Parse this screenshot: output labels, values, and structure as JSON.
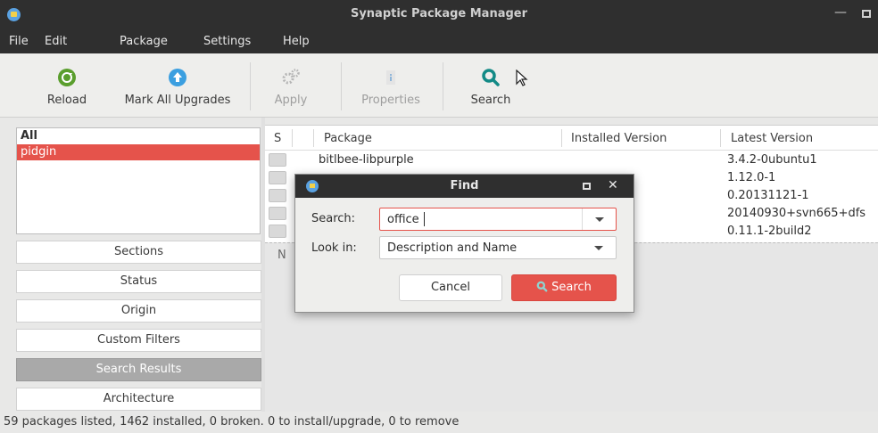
{
  "window": {
    "title": "Synaptic Package Manager"
  },
  "menu": [
    "File",
    "Edit",
    "Package",
    "Settings",
    "Help"
  ],
  "toolbar": {
    "reload": "Reload",
    "mark_all_upgrades": "Mark All Upgrades",
    "apply": "Apply",
    "properties": "Properties",
    "search": "Search"
  },
  "filter_list": {
    "items": [
      "All",
      "pidgin"
    ],
    "selected": "pidgin"
  },
  "sidebar": {
    "sections": "Sections",
    "status": "Status",
    "origin": "Origin",
    "custom_filters": "Custom Filters",
    "search_results": "Search Results",
    "architecture": "Architecture"
  },
  "packages": {
    "columns": [
      "S",
      "Package",
      "Installed Version",
      "Latest Version"
    ],
    "rows": [
      {
        "name": "bitlbee-libpurple",
        "latest": "3.4.2-0ubuntu1"
      },
      {
        "name": "",
        "latest": "1.12.0-1"
      },
      {
        "name": "",
        "latest": "0.20131121-1"
      },
      {
        "name": "",
        "latest": "20140930+svn665+dfs"
      },
      {
        "name": "",
        "latest": "0.11.1-2build2"
      }
    ]
  },
  "description": {
    "placeholder": "N"
  },
  "status_bar": "59 packages listed, 1462 installed, 0 broken. 0 to install/upgrade, 0 to remove",
  "find_dialog": {
    "title": "Find",
    "search_label": "Search:",
    "search_value": "office",
    "look_in_label": "Look in:",
    "look_in_value": "Description and Name",
    "cancel": "Cancel",
    "search_button": "Search"
  },
  "colors": {
    "accent": "#e5534b",
    "titlebar": "#2f2f2f",
    "search_icon": "#138a86",
    "reload_icon": "#5a9e2d",
    "upgrade_icon": "#3b9fe0"
  }
}
